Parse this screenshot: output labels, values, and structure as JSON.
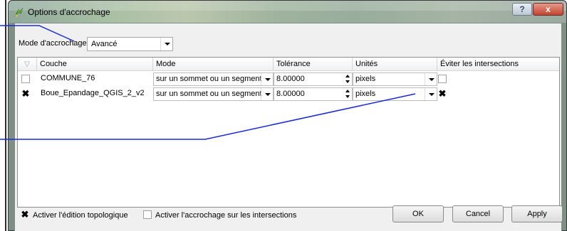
{
  "window": {
    "title": "Options d'accrochage",
    "help_label": "?",
    "close_label": "x"
  },
  "mode": {
    "label": "Mode d'accrochage",
    "value": "Avancé"
  },
  "table": {
    "columns": [
      "Couche",
      "Mode",
      "Tolérance",
      "Unités",
      "Éviter les intersections"
    ],
    "rows": [
      {
        "checked": false,
        "layer": "COMMUNE_76",
        "mode": "sur un sommet ou un segment",
        "tolerance": "8.00000",
        "units": "pixels",
        "avoid_intersections": false
      },
      {
        "checked": true,
        "layer": "Boue_Epandage_QGIS_2_v2",
        "mode": "sur un sommet ou un segment",
        "tolerance": "8.00000",
        "units": "pixels",
        "avoid_intersections": true
      }
    ]
  },
  "footer": {
    "topological_editing": {
      "label": "Activer l'édition topologique",
      "checked": true
    },
    "snap_on_intersections": {
      "label": "Activer l'accrochage sur les intersections",
      "checked": false
    },
    "ok_label": "OK",
    "cancel_label": "Cancel",
    "apply_label": "Apply"
  },
  "colors": {
    "annotation_line": "#1a2ad6",
    "selection_border": "#8e8e8e"
  }
}
